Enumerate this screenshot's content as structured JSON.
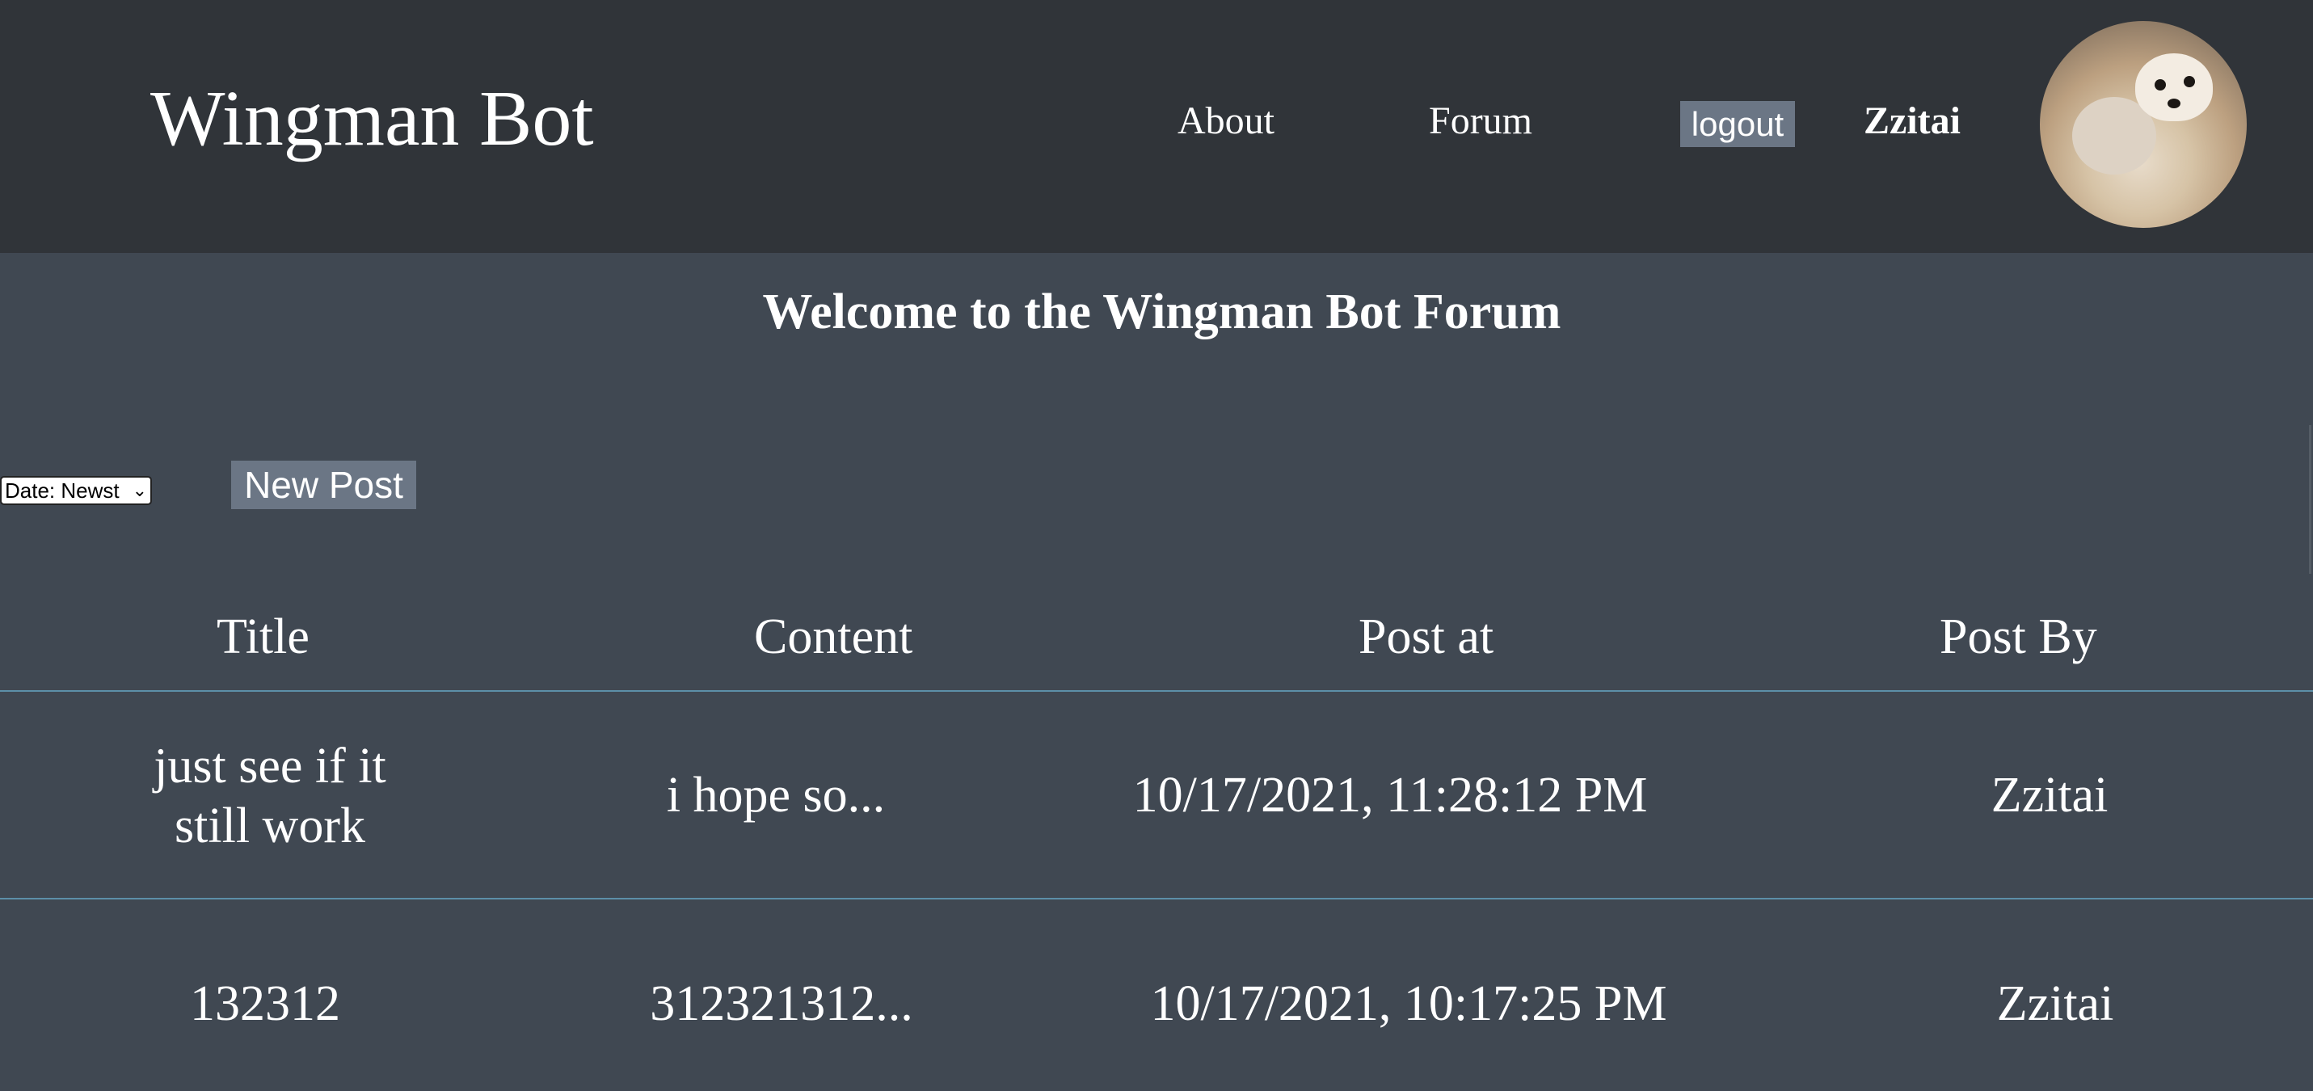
{
  "header": {
    "brand": "Wingman Bot",
    "nav": {
      "about": "About",
      "forum": "Forum",
      "logout": "logout"
    },
    "username": "Zzitai",
    "avatar_icon": "avatar-photo-dogs"
  },
  "main": {
    "welcome": "Welcome to the Wingman Bot Forum",
    "sort_select": {
      "value": "Date: Newst"
    },
    "new_post_label": "New Post",
    "table": {
      "headers": [
        "Title",
        "Content",
        "Post at",
        "Post By"
      ],
      "rows": [
        {
          "title_line1": "just see if it",
          "title_line2": "still work",
          "content": "i hope so...",
          "post_at": "10/17/2021, 11:28:12 PM",
          "post_by": "Zzitai"
        },
        {
          "title": "132312",
          "content": "312321312...",
          "post_at": "10/17/2021, 10:17:25 PM",
          "post_by": "Zzitai"
        }
      ]
    }
  },
  "colors": {
    "header_bg": "#303439",
    "page_bg": "#404852",
    "button_bg": "#6b7685",
    "divider": "#5c8fa8",
    "text": "#ffffff"
  }
}
